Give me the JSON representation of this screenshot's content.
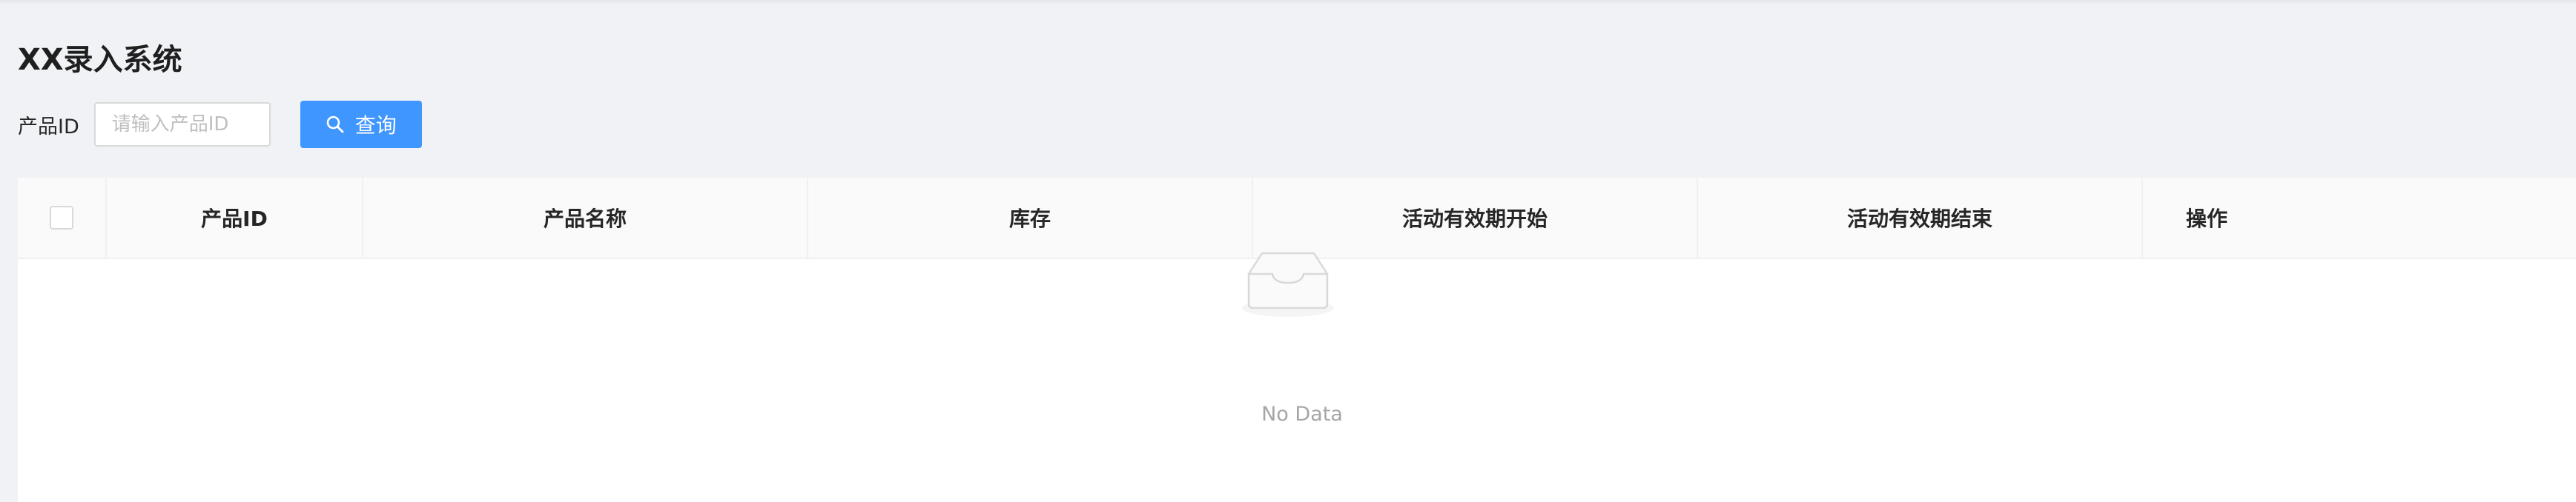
{
  "header": {
    "title": "XX录入系统"
  },
  "search": {
    "label": "产品ID",
    "value": "",
    "placeholder": "请输入产品ID",
    "button_label": "查询",
    "button_icon": "search-icon",
    "accent_color": "#4096ff"
  },
  "table": {
    "columns": [
      "产品ID",
      "产品名称",
      "库存",
      "活动有效期开始",
      "活动有效期结束",
      "操作"
    ],
    "rows": [],
    "empty_text": "No Data",
    "empty_icon": "inbox-icon"
  }
}
